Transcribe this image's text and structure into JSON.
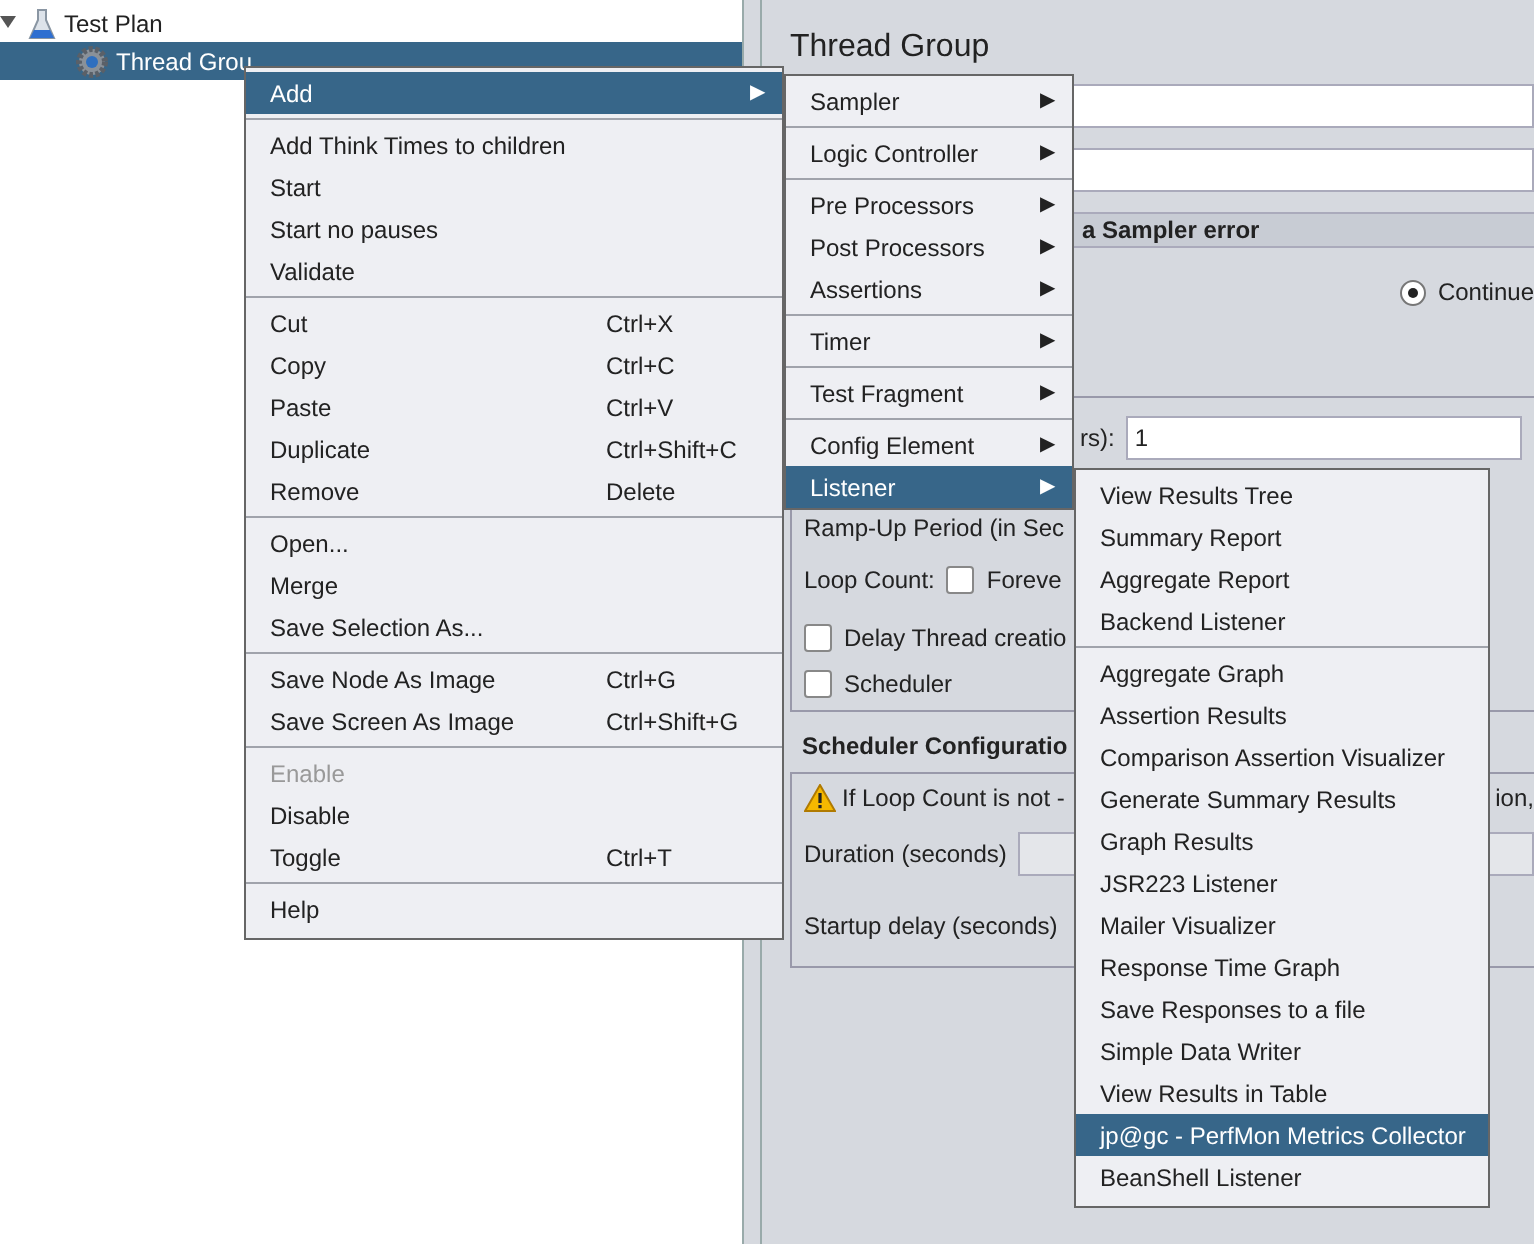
{
  "tree": [
    {
      "label": "Test Plan",
      "expanded": true,
      "selected": false,
      "children": [
        {
          "label": "Thread Grou",
          "selected": true
        }
      ]
    }
  ],
  "panel": {
    "title": "Thread Group",
    "error_section": "a Sampler error",
    "error_action": {
      "label": "Continue",
      "selected": true
    },
    "threads": {
      "label": "rs):",
      "value": "1"
    },
    "ramp_up": {
      "label": "Ramp-Up Period (in Sec"
    },
    "loop_count": {
      "label": "Loop Count:",
      "forever": {
        "label": "Foreve",
        "checked": false
      }
    },
    "options": [
      {
        "label": "Delay Thread creatio",
        "checked": false
      },
      {
        "label": "Scheduler",
        "checked": false
      }
    ],
    "scheduler_section": "Scheduler Configuratio",
    "warning": [
      "If Loop Count is not -",
      "ion,"
    ],
    "duration": {
      "label": "Duration (seconds)"
    },
    "startup_delay": {
      "label": "Startup delay (seconds)"
    }
  },
  "menus": [
    {
      "groups": [
        [
          {
            "label": "Add",
            "arrow": "▶",
            "selected": true,
            "disabled": false
          }
        ],
        [
          {
            "label": "Add Think Times to children",
            "selected": false,
            "disabled": false
          },
          {
            "label": "Start",
            "selected": false,
            "disabled": false
          },
          {
            "label": "Start no pauses",
            "selected": false,
            "disabled": false
          },
          {
            "label": "Validate",
            "selected": false,
            "disabled": false
          }
        ],
        [
          {
            "label": "Cut",
            "shortcut": "Ctrl+X",
            "selected": false,
            "disabled": false
          },
          {
            "label": "Copy",
            "shortcut": "Ctrl+C",
            "selected": false,
            "disabled": false
          },
          {
            "label": "Paste",
            "shortcut": "Ctrl+V",
            "selected": false,
            "disabled": false
          },
          {
            "label": "Duplicate",
            "shortcut": "Ctrl+Shift+C",
            "selected": false,
            "disabled": false
          },
          {
            "label": "Remove",
            "shortcut": "Delete",
            "selected": false,
            "disabled": false
          }
        ],
        [
          {
            "label": "Open...",
            "selected": false,
            "disabled": false
          },
          {
            "label": "Merge",
            "selected": false,
            "disabled": false
          },
          {
            "label": "Save Selection As...",
            "selected": false,
            "disabled": false
          }
        ],
        [
          {
            "label": "Save Node As Image",
            "shortcut": "Ctrl+G",
            "selected": false,
            "disabled": false
          },
          {
            "label": "Save Screen As Image",
            "shortcut": "Ctrl+Shift+G",
            "selected": false,
            "disabled": false
          }
        ],
        [
          {
            "label": "Enable",
            "selected": false,
            "disabled": true
          },
          {
            "label": "Disable",
            "selected": false,
            "disabled": false
          },
          {
            "label": "Toggle",
            "shortcut": "Ctrl+T",
            "selected": false,
            "disabled": false
          }
        ],
        [
          {
            "label": "Help",
            "selected": false,
            "disabled": false
          }
        ]
      ]
    },
    {
      "groups": [
        [
          {
            "label": "Sampler",
            "arrow": "▶",
            "selected": false,
            "disabled": false
          }
        ],
        [
          {
            "label": "Logic Controller",
            "arrow": "▶",
            "selected": false,
            "disabled": false
          }
        ],
        [
          {
            "label": "Pre Processors",
            "arrow": "▶",
            "selected": false,
            "disabled": false
          },
          {
            "label": "Post Processors",
            "arrow": "▶",
            "selected": false,
            "disabled": false
          },
          {
            "label": "Assertions",
            "arrow": "▶",
            "selected": false,
            "disabled": false
          }
        ],
        [
          {
            "label": "Timer",
            "arrow": "▶",
            "selected": false,
            "disabled": false
          }
        ],
        [
          {
            "label": "Test Fragment",
            "arrow": "▶",
            "selected": false,
            "disabled": false
          }
        ],
        [
          {
            "label": "Config Element",
            "arrow": "▶",
            "selected": false,
            "disabled": false
          },
          {
            "label": "Listener",
            "arrow": "▶",
            "selected": true,
            "disabled": false
          }
        ]
      ]
    },
    {
      "groups": [
        [
          {
            "label": "View Results Tree",
            "selected": false,
            "disabled": false
          },
          {
            "label": "Summary Report",
            "selected": false,
            "disabled": false
          },
          {
            "label": "Aggregate Report",
            "selected": false,
            "disabled": false
          },
          {
            "label": "Backend Listener",
            "selected": false,
            "disabled": false
          }
        ],
        [
          {
            "label": "Aggregate Graph",
            "selected": false,
            "disabled": false
          },
          {
            "label": "Assertion Results",
            "selected": false,
            "disabled": false
          },
          {
            "label": "Comparison Assertion Visualizer",
            "selected": false,
            "disabled": false
          },
          {
            "label": "Generate Summary Results",
            "selected": false,
            "disabled": false
          },
          {
            "label": "Graph Results",
            "selected": false,
            "disabled": false
          },
          {
            "label": "JSR223 Listener",
            "selected": false,
            "disabled": false
          },
          {
            "label": "Mailer Visualizer",
            "selected": false,
            "disabled": false
          },
          {
            "label": "Response Time Graph",
            "selected": false,
            "disabled": false
          },
          {
            "label": "Save Responses to a file",
            "selected": false,
            "disabled": false
          },
          {
            "label": "Simple Data Writer",
            "selected": false,
            "disabled": false
          },
          {
            "label": "View Results in Table",
            "selected": false,
            "disabled": false
          },
          {
            "label": "jp@gc - PerfMon Metrics Collector",
            "selected": true,
            "disabled": false
          },
          {
            "label": "BeanShell Listener",
            "selected": false,
            "disabled": false
          }
        ]
      ]
    }
  ]
}
